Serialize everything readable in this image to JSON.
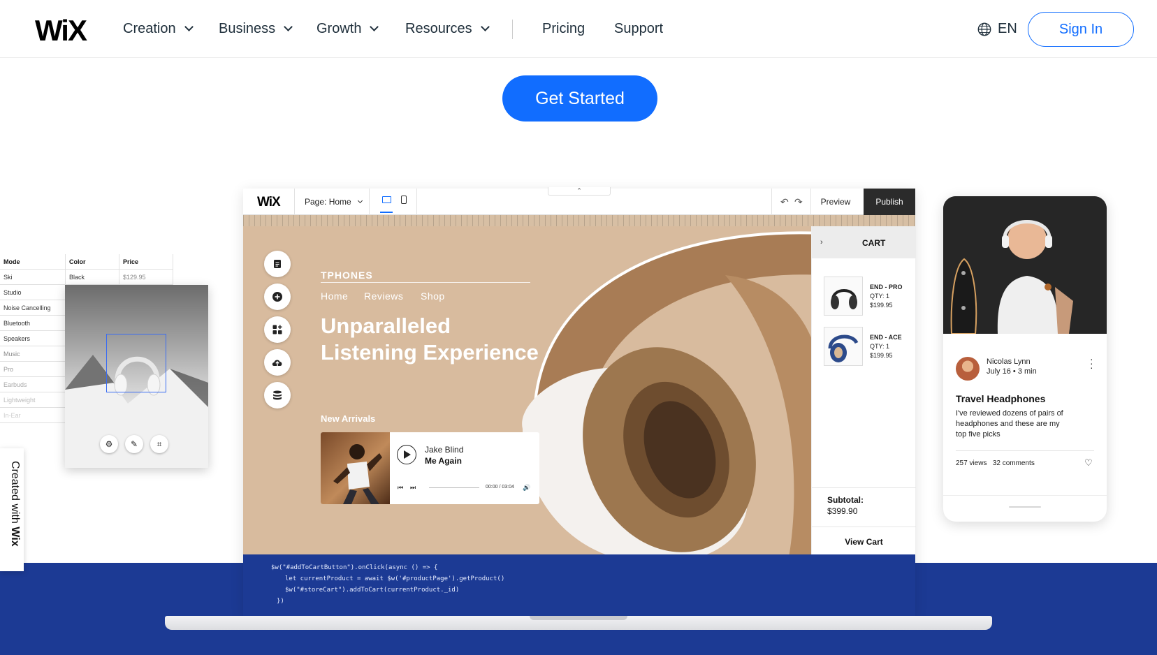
{
  "header": {
    "logo": "WiX",
    "nav": [
      {
        "label": "Creation",
        "dropdown": true
      },
      {
        "label": "Business",
        "dropdown": true
      },
      {
        "label": "Growth",
        "dropdown": true
      },
      {
        "label": "Resources",
        "dropdown": true
      },
      {
        "label": "Pricing",
        "dropdown": false
      },
      {
        "label": "Support",
        "dropdown": false
      }
    ],
    "language": "EN",
    "sign_in": "Sign In"
  },
  "cta": {
    "label": "Get Started"
  },
  "colors": {
    "accent": "#116dff",
    "band": "#1c3a94",
    "canvas": "#d8bb9e"
  },
  "editor": {
    "logo": "WiX",
    "page_selector": "Page: Home",
    "preview": "Preview",
    "publish": "Publish",
    "tools": [
      "pages-icon",
      "add-icon",
      "apps-icon",
      "upload-icon",
      "database-icon"
    ],
    "site": {
      "brand": "TPHONES",
      "nav": [
        "Home",
        "Reviews",
        "Shop"
      ],
      "hero_line1": "Unparalleled",
      "hero_line2": "Listening Experience",
      "new_arrivals": "New Arrivals",
      "player": {
        "artist": "Jake Blind",
        "song": "Me Again",
        "time": "00:00 / 03:04"
      }
    },
    "cart": {
      "title": "CART",
      "items": [
        {
          "name": "END - PRO",
          "qty": "QTY: 1",
          "price": "$199.95"
        },
        {
          "name": "END - ACE",
          "qty": "QTY: 1",
          "price": "$199.95"
        }
      ],
      "subtotal_label": "Subtotal:",
      "subtotal_value": "$399.90",
      "view_cart": "View Cart"
    },
    "code": [
      "$w(\"#addToCartButton\").onClick(async () => {",
      "let currentProduct = await $w('#productPage').getProduct()",
      "$w(\"#storeCart\").addToCart(currentProduct._id)",
      "})"
    ]
  },
  "sheet": {
    "headers": [
      "Mode",
      "Color",
      "Price"
    ],
    "first_row": [
      "Ski",
      "Black",
      "$129.95"
    ],
    "modes": [
      "Studio",
      "Noise Cancelling",
      "Bluetooth",
      "Speakers",
      "Music",
      "Pro",
      "Earbuds",
      "Lightweight",
      "In-Ear"
    ]
  },
  "created_with": {
    "prefix": "Created with",
    "brand": "Wix"
  },
  "blog_card": {
    "author": "Nicolas Lynn",
    "meta": "July 16 • 3 min",
    "title": "Travel Headphones",
    "body": "I've reviewed dozens of pairs of headphones and these are my top five picks",
    "views": "257 views",
    "comments": "32 comments"
  }
}
